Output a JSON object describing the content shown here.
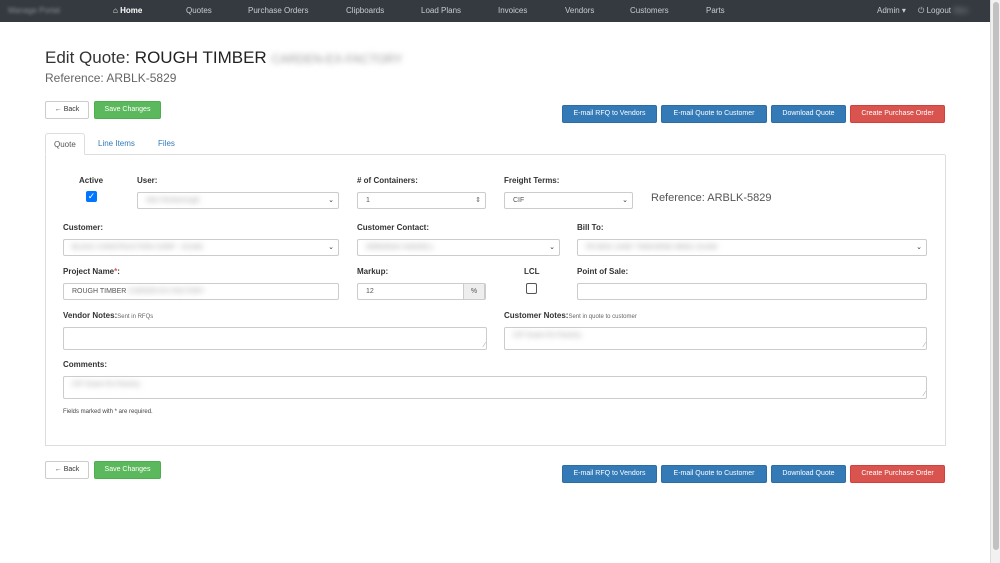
{
  "nav": {
    "brand": "Manage Portal",
    "home": "Home",
    "items": [
      "Quotes",
      "Purchase Orders",
      "Clipboards",
      "Load Plans",
      "Invoices",
      "Vendors",
      "Customers",
      "Parts"
    ],
    "admin": "Admin",
    "logout": "Logout",
    "user": "Alex"
  },
  "page": {
    "title_prefix": "Edit Quote:",
    "title_name": "ROUGH TIMBER",
    "title_hidden": "CARDEN-EX-FACTORY",
    "reference": "Reference: ARBLK-5829"
  },
  "actions": {
    "back": "Back",
    "save": "Save Changes",
    "email_rfq": "E-mail RFQ to Vendors",
    "email_quote": "E-mail Quote to Customer",
    "download": "Download Quote",
    "create_po": "Create Purchase Order"
  },
  "tabs": [
    "Quote",
    "Line Items",
    "Files"
  ],
  "form": {
    "active_label": "Active",
    "active": true,
    "user_label": "User:",
    "user_value": "Alex Rexborough",
    "containers_label": "# of Containers:",
    "containers_value": "1",
    "freight_label": "Freight Terms:",
    "freight_value": "CIF",
    "reference_inline": "Reference: ARBLK-5829",
    "customer_label": "Customer:",
    "customer_value": "BLACK CONSTRUCTION CORP - GUAM",
    "contact_label": "Customer Contact:",
    "contact_value": "DEBORAH HANSELL",
    "billto_label": "Bill To:",
    "billto_value": "PO BOX 24467 TAMUNING 96931 GUAM",
    "project_label": "Project Name",
    "project_req": "*",
    "project_colon": ":",
    "project_value": "ROUGH TIMBER",
    "project_value_hidden": "CARDEN-EX-FACTORY",
    "markup_label": "Markup:",
    "markup_value": "12",
    "markup_unit": "%",
    "lcl_label": "LCL",
    "lcl": false,
    "pos_label": "Point of Sale:",
    "pos_value": "",
    "vendor_notes_label": "Vendor Notes:",
    "vendor_notes_hint": "Sent in RFQs",
    "vendor_notes_value": "",
    "customer_notes_label": "Customer Notes:",
    "customer_notes_hint": "Sent in quote to customer",
    "customer_notes_value": "CIF Guam Ex-Factory",
    "comments_label": "Comments:",
    "comments_value": "CIF Guam Ex-Factory",
    "required_note": "Fields marked with * are required."
  },
  "icons": {
    "home": "home-icon",
    "back": "arrow-left-icon",
    "power": "power-icon",
    "caret": "caret-down-icon",
    "check": "checkmark-icon"
  },
  "colors": {
    "navbar": "#343a40",
    "success": "#5cb85c",
    "primary": "#337ab7",
    "danger": "#d9534f"
  }
}
